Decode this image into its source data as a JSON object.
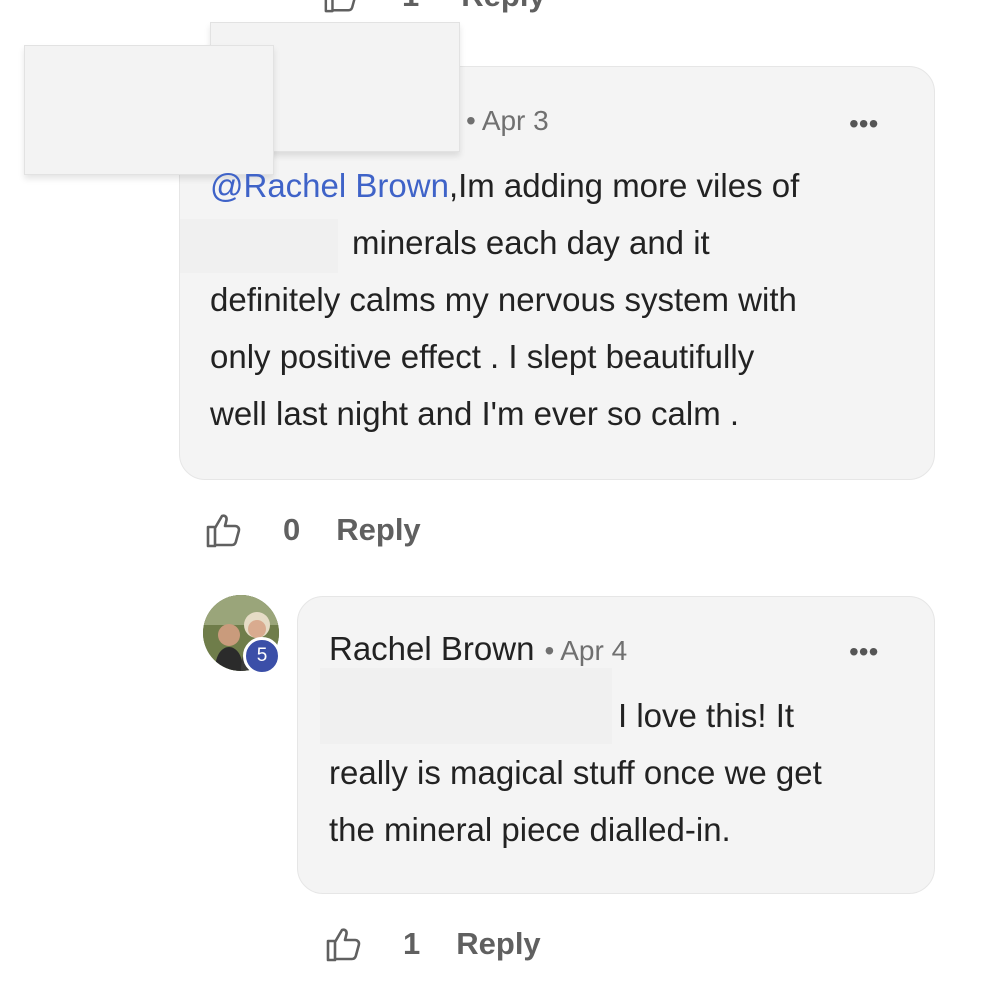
{
  "top_actions": {
    "like_count": "1",
    "reply_label": "Reply"
  },
  "comment1": {
    "timestamp": "Apr 3",
    "more_label": "•••",
    "mention": "@Rachel Brown",
    "lines": [
      ",Im adding more viles of",
      "minerals each day and it",
      "definitely calms my nervous system with",
      "only positive effect . I slept beautifully",
      "well last night and I'm ever so calm ."
    ],
    "like_count": "0",
    "reply_label": "Reply"
  },
  "comment2": {
    "author": "Rachel Brown",
    "timestamp": "Apr 4",
    "more_label": "•••",
    "badge": "5",
    "lines": [
      "I love this! It",
      "really is magical stuff once we get",
      "the mineral piece dialled-in."
    ],
    "like_count": "1",
    "reply_label": "Reply"
  },
  "colors": {
    "mention": "#3f63c8",
    "badge": "#3b4fa8",
    "bubble": "#f4f4f4",
    "action_text": "#606060"
  },
  "icons": {
    "like": "thumbs-up-icon",
    "more": "more-options-icon"
  }
}
